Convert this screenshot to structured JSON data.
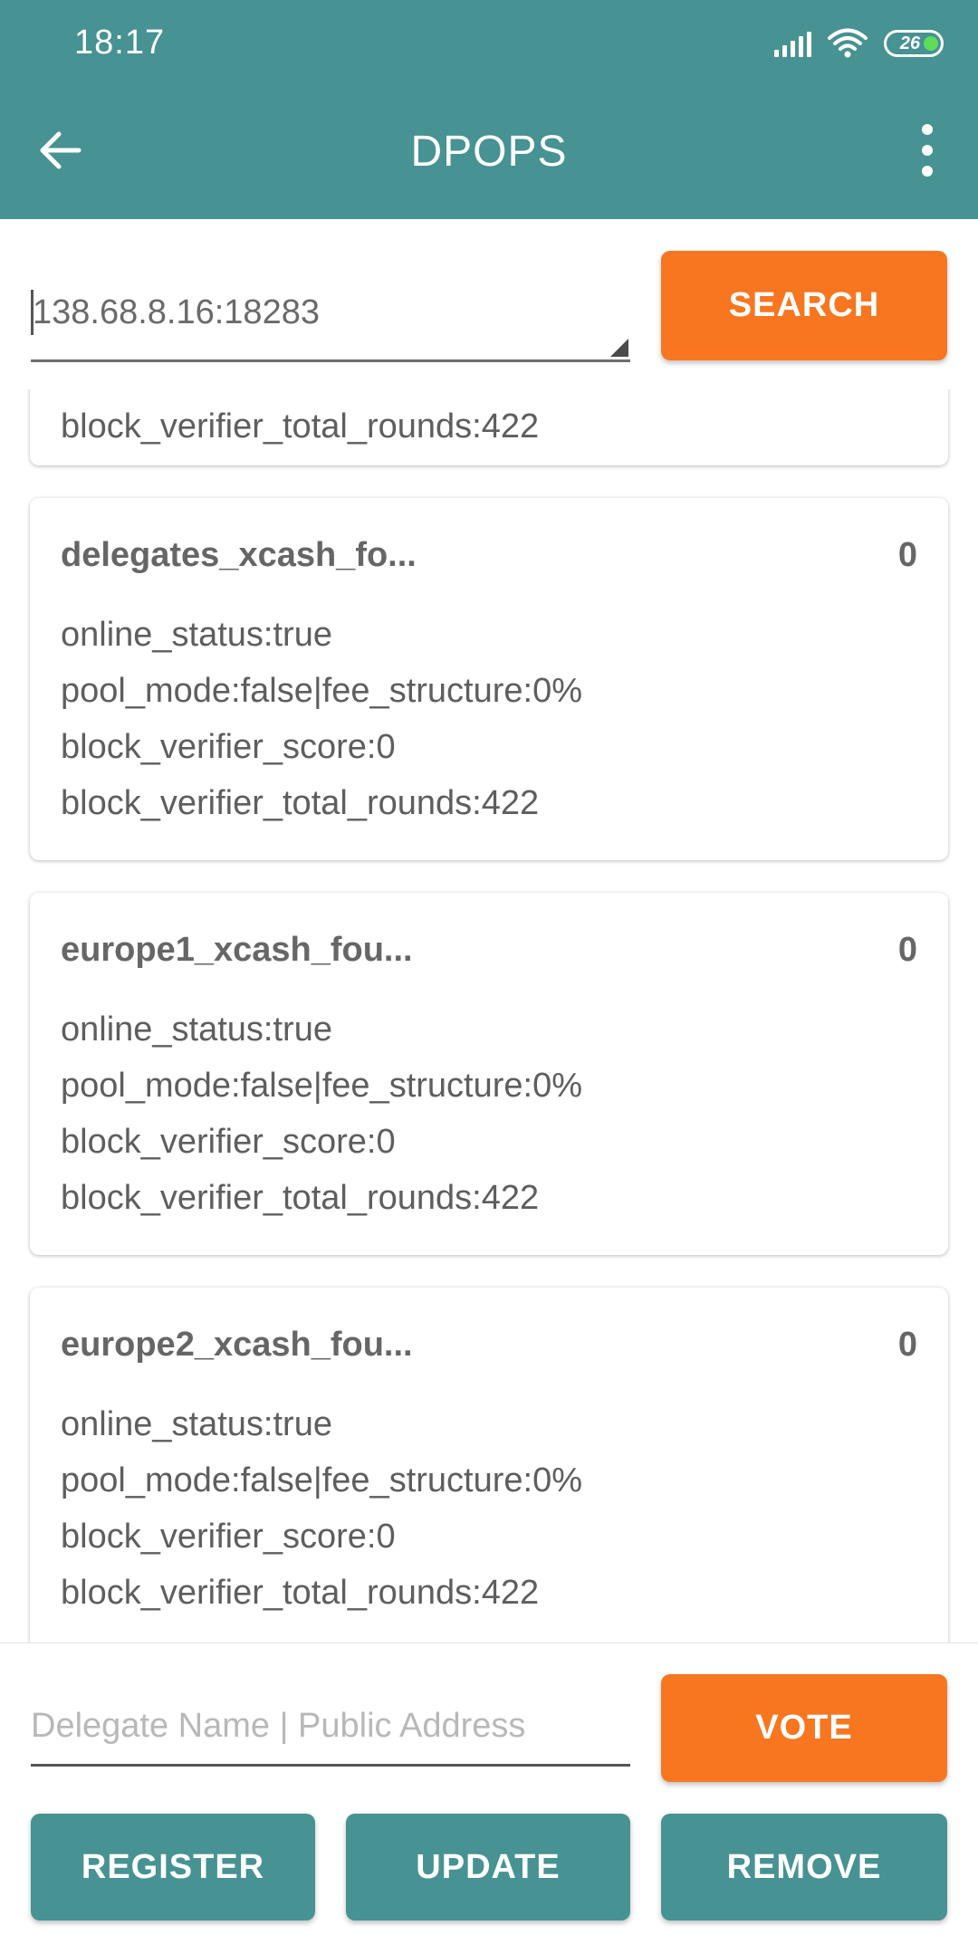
{
  "status_bar": {
    "time": "18:17",
    "battery": "26"
  },
  "app_bar": {
    "title": "DPOPS"
  },
  "search": {
    "value": "138.68.8.16:18283",
    "button_label": "SEARCH"
  },
  "partial_card": {
    "line": "block_verifier_total_rounds:422"
  },
  "delegates": [
    {
      "name": "delegates_xcash_fo...",
      "rank": "0",
      "online_status": "online_status:true",
      "pool": "pool_mode:false|fee_structure:0%",
      "score": "block_verifier_score:0",
      "rounds": "block_verifier_total_rounds:422"
    },
    {
      "name": "europe1_xcash_fou...",
      "rank": "0",
      "online_status": "online_status:true",
      "pool": "pool_mode:false|fee_structure:0%",
      "score": "block_verifier_score:0",
      "rounds": "block_verifier_total_rounds:422"
    },
    {
      "name": "europe2_xcash_fou...",
      "rank": "0",
      "online_status": "online_status:true",
      "pool": "pool_mode:false|fee_structure:0%",
      "score": "block_verifier_score:0",
      "rounds": "block_verifier_total_rounds:422"
    }
  ],
  "vote": {
    "placeholder": "Delegate Name | Public Address",
    "button_label": "VOTE"
  },
  "actions": {
    "register": "REGISTER",
    "update": "UPDATE",
    "remove": "REMOVE"
  },
  "colors": {
    "primary": "#479292",
    "accent": "#f7761f"
  },
  "icons": [
    "signal-icon",
    "wifi-icon",
    "battery-icon",
    "back-arrow-icon",
    "more-vert-icon",
    "dropdown-arrow-icon"
  ]
}
